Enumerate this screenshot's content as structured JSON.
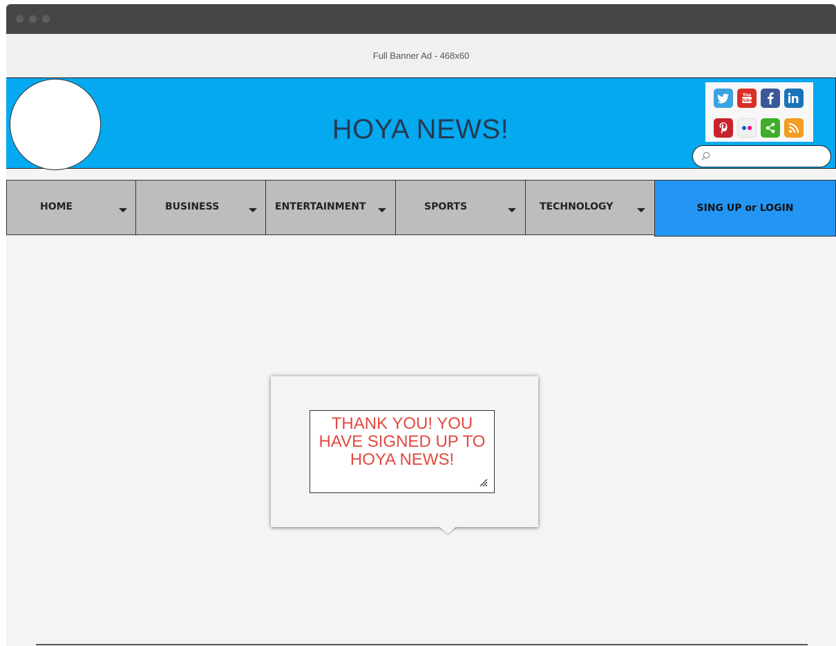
{
  "ad": {
    "label": "Full Banner Ad - 468x60"
  },
  "header": {
    "title": "HOYA NEWS!"
  },
  "social": [
    {
      "name": "twitter",
      "glyph": "t",
      "color": "#3aa3e3"
    },
    {
      "name": "youtube",
      "glyph": "You Tube",
      "color": "#d93025"
    },
    {
      "name": "facebook",
      "glyph": "f",
      "color": "#3b5998"
    },
    {
      "name": "linkedin",
      "glyph": "in",
      "color": "#1a73b8"
    },
    {
      "name": "pinterest",
      "glyph": "p",
      "color": "#c8232c"
    },
    {
      "name": "flickr",
      "glyph": "••",
      "color": "#f0f0f0"
    },
    {
      "name": "share",
      "glyph": "<",
      "color": "#3fae2a"
    },
    {
      "name": "rss",
      "glyph": ")",
      "color": "#f39c20"
    }
  ],
  "search": {
    "placeholder": ""
  },
  "nav": {
    "items": [
      {
        "label": "HOME"
      },
      {
        "label": "BUSINESS"
      },
      {
        "label": "ENTERTAINMENT"
      },
      {
        "label": "SPORTS"
      },
      {
        "label": "TECHNOLOGY"
      }
    ],
    "login": "SING UP or LOGIN"
  },
  "popup": {
    "message_line1": "THANK YOU!  YOU",
    "message_line2": "HAVE SIGNED UP TO",
    "message_line3": "HOYA NEWS!"
  }
}
